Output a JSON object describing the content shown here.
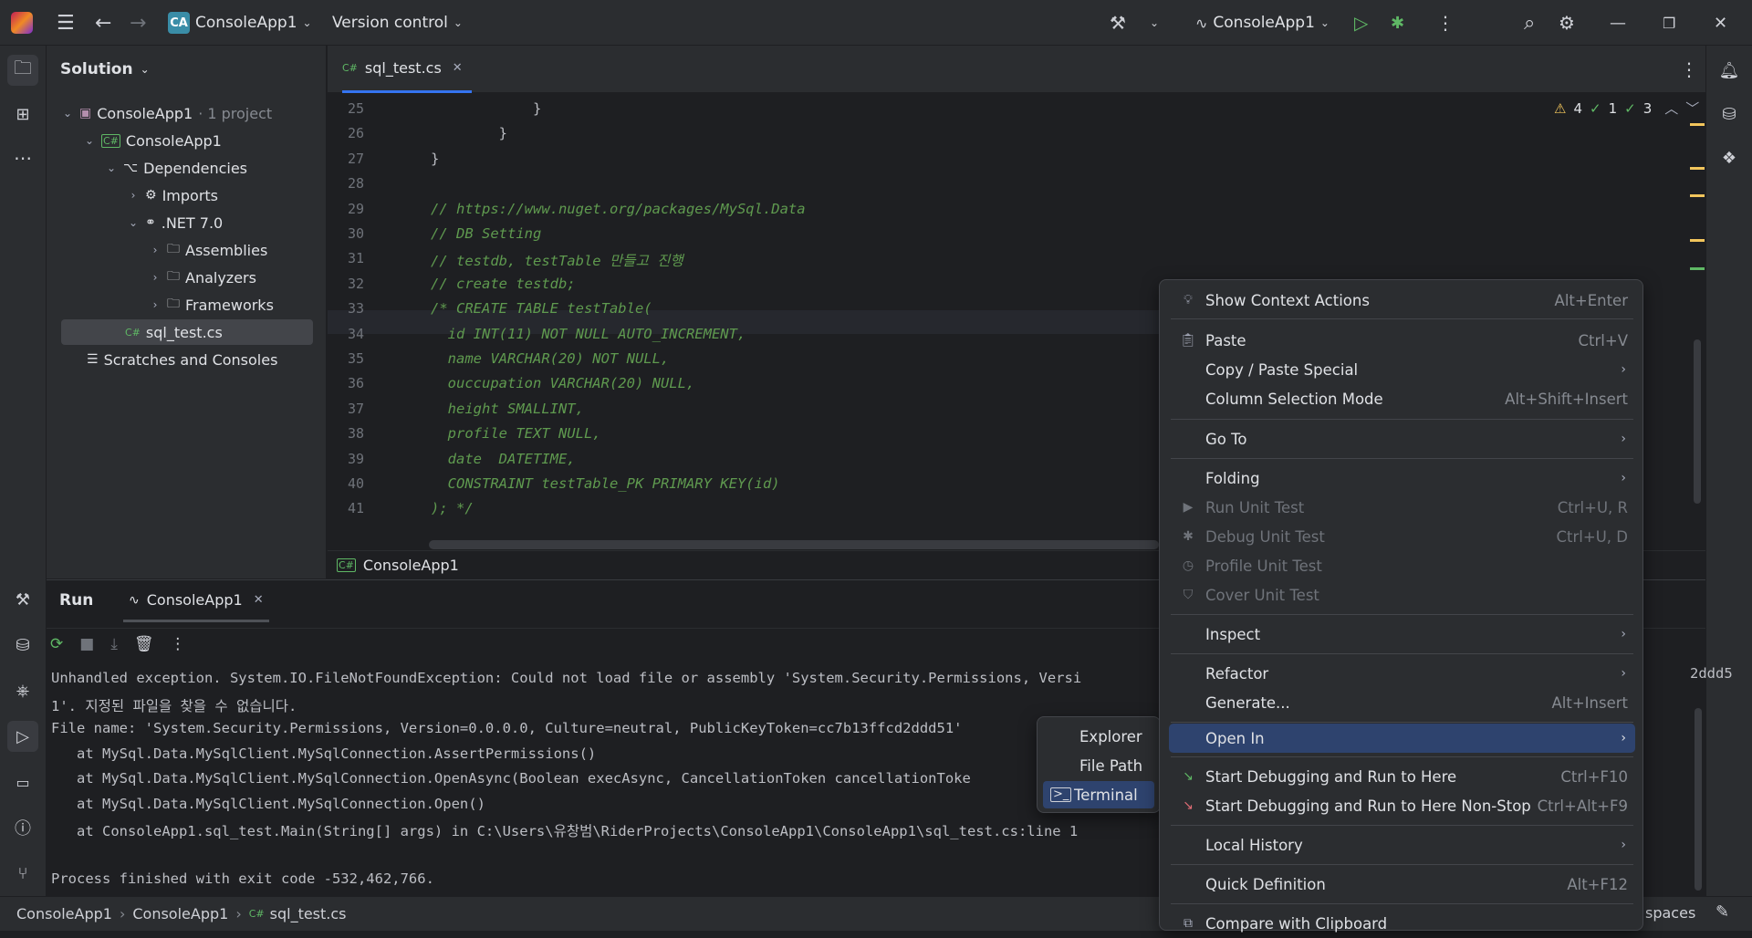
{
  "titlebar": {
    "project_badge": "CA",
    "project": "ConsoleApp1",
    "vcs": "Version control",
    "run_config": "ConsoleApp1"
  },
  "solution": {
    "title": "Solution",
    "tree": [
      {
        "label": "ConsoleApp1",
        "suffix": " · 1 project"
      },
      {
        "label": "ConsoleApp1"
      },
      {
        "label": "Dependencies"
      },
      {
        "label": "Imports"
      },
      {
        "label": ".NET 7.0"
      },
      {
        "label": "Assemblies"
      },
      {
        "label": "Analyzers"
      },
      {
        "label": "Frameworks"
      },
      {
        "label": "sql_test.cs"
      },
      {
        "label": "Scratches and Consoles"
      }
    ]
  },
  "editor": {
    "tab": "sql_test.cs",
    "breadcrumb": "ConsoleApp1",
    "inspections": {
      "warnings": "4",
      "ok1": "1",
      "ok2": "3"
    },
    "lines": [
      {
        "n": "25",
        "t": "            }",
        "plain": true
      },
      {
        "n": "26",
        "t": "        }",
        "plain": true
      },
      {
        "n": "27",
        "t": "}",
        "plain": true
      },
      {
        "n": "28",
        "t": "",
        "plain": true
      },
      {
        "n": "29",
        "t": "// https://www.nuget.org/packages/MySql.Data"
      },
      {
        "n": "30",
        "t": "// DB Setting"
      },
      {
        "n": "31",
        "t": "// testdb, testTable 만들고 진행"
      },
      {
        "n": "32",
        "t": "// create testdb;"
      },
      {
        "n": "33",
        "t": "/* CREATE TABLE testTable("
      },
      {
        "n": "34",
        "t": "  id INT(11) NOT NULL AUTO_INCREMENT,"
      },
      {
        "n": "35",
        "t": "  name VARCHAR(20) NOT NULL,"
      },
      {
        "n": "36",
        "t": "  ouccupation VARCHAR(20) NULL,"
      },
      {
        "n": "37",
        "t": "  height SMALLINT,"
      },
      {
        "n": "38",
        "t": "  profile TEXT NULL,"
      },
      {
        "n": "39",
        "t": "  date  DATETIME,"
      },
      {
        "n": "40",
        "t": "  CONSTRAINT testTable_PK PRIMARY KEY(id)"
      },
      {
        "n": "41",
        "t": "); */"
      }
    ]
  },
  "run": {
    "title": "Run",
    "tab": "ConsoleApp1",
    "output": [
      "Unhandled exception. System.IO.FileNotFoundException: Could not load file or assembly 'System.Security.Permissions, Versi",
      "1'. 지정된 파일을 찾을 수 없습니다.",
      "File name: 'System.Security.Permissions, Version=0.0.0.0, Culture=neutral, PublicKeyToken=cc7b13ffcd2ddd51'",
      "   at MySql.Data.MySqlClient.MySqlConnection.AssertPermissions()",
      "   at MySql.Data.MySqlClient.MySqlConnection.OpenAsync(Boolean execAsync, CancellationToken cancellationToke",
      "   at MySql.Data.MySqlClient.MySqlConnection.Open()",
      "   at ConsoleApp1.sql_test.Main(String[] args) in C:\\Users\\유창범\\RiderProjects\\ConsoleApp1\\ConsoleApp1\\sql_test.cs:line 1",
      "",
      "Process finished with exit code -532,462,766."
    ],
    "overflow_right": "2ddd5"
  },
  "statusbar": {
    "crumbs": [
      "ConsoleApp1",
      "ConsoleApp1",
      "sql_test.cs"
    ],
    "right": "spaces"
  },
  "context_menu": {
    "items": [
      {
        "label": "Show Context Actions",
        "shortcut": "Alt+Enter"
      },
      {
        "label": "Paste",
        "shortcut": "Ctrl+V"
      },
      {
        "label": "Copy / Paste Special"
      },
      {
        "label": "Column Selection Mode",
        "shortcut": "Alt+Shift+Insert"
      },
      {
        "label": "Go To"
      },
      {
        "label": "Folding"
      },
      {
        "label": "Run Unit Test",
        "shortcut": "Ctrl+U, R"
      },
      {
        "label": "Debug Unit Test",
        "shortcut": "Ctrl+U, D"
      },
      {
        "label": "Profile Unit Test"
      },
      {
        "label": "Cover Unit Test"
      },
      {
        "label": "Inspect"
      },
      {
        "label": "Refactor"
      },
      {
        "label": "Generate...",
        "shortcut": "Alt+Insert"
      },
      {
        "label": "Open In"
      },
      {
        "label": "Start Debugging and Run to Here",
        "shortcut": "Ctrl+F10"
      },
      {
        "label": "Start Debugging and Run to Here Non-Stop",
        "shortcut": "Ctrl+Alt+F9"
      },
      {
        "label": "Local History"
      },
      {
        "label": "Quick Definition",
        "shortcut": "Alt+F12"
      },
      {
        "label": "Compare with Clipboard"
      }
    ]
  },
  "submenu": {
    "items": [
      {
        "label": "Explorer"
      },
      {
        "label": "File Path"
      },
      {
        "label": "Terminal"
      }
    ]
  },
  "colors": {
    "accent": "#2e436e",
    "run_green": "#5fb865",
    "comment": "#5f9a4f"
  }
}
